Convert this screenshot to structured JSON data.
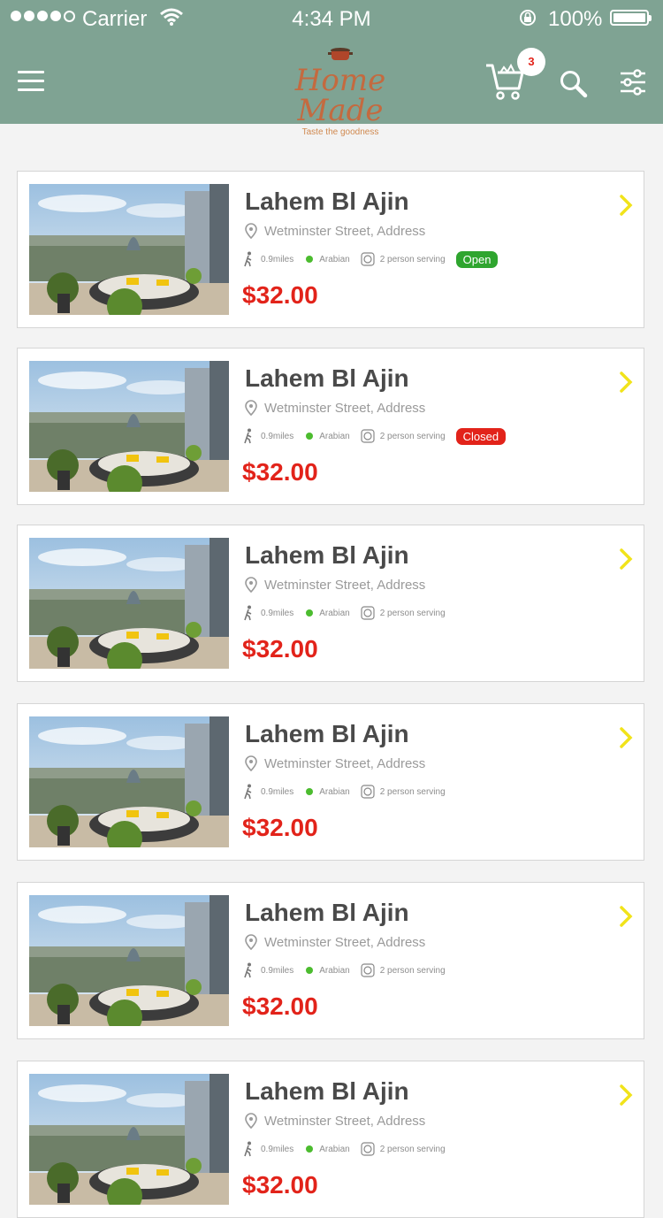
{
  "status": {
    "carrier": "Carrier",
    "time": "4:34 PM",
    "battery": "100%"
  },
  "header": {
    "brand": "Home Made",
    "tagline": "Taste the goodness",
    "cart_count": "3",
    "colors": {
      "bar": "#7fa393",
      "brand": "#c46a3f",
      "badge_text": "#e2231a"
    }
  },
  "items": [
    {
      "name": "Lahem Bl Ajin",
      "address": "Wetminster Street, Address",
      "distance": "0.9miles",
      "cuisine": "Arabian",
      "serving": "2 person serving",
      "status": "Open",
      "price": "$32.00"
    },
    {
      "name": "Lahem Bl Ajin",
      "address": "Wetminster Street, Address",
      "distance": "0.9miles",
      "cuisine": "Arabian",
      "serving": "2 person serving",
      "status": "Closed",
      "price": "$32.00"
    },
    {
      "name": "Lahem Bl Ajin",
      "address": "Wetminster Street, Address",
      "distance": "0.9miles",
      "cuisine": "Arabian",
      "serving": "2 person serving",
      "status": "",
      "price": "$32.00"
    },
    {
      "name": "Lahem Bl Ajin",
      "address": "Wetminster Street, Address",
      "distance": "0.9miles",
      "cuisine": "Arabian",
      "serving": "2 person serving",
      "status": "",
      "price": "$32.00"
    },
    {
      "name": "Lahem Bl Ajin",
      "address": "Wetminster Street, Address",
      "distance": "0.9miles",
      "cuisine": "Arabian",
      "serving": "2 person serving",
      "status": "",
      "price": "$32.00"
    },
    {
      "name": "Lahem Bl Ajin",
      "address": "Wetminster Street, Address",
      "distance": "0.9miles",
      "cuisine": "Arabian",
      "serving": "2 person serving",
      "status": "",
      "price": "$32.00"
    }
  ],
  "icons": [
    "menu-icon",
    "pot-icon",
    "cart-icon",
    "search-icon",
    "filter-icon",
    "location-pin-icon",
    "walking-icon",
    "plate-icon",
    "chevron-right-icon"
  ]
}
